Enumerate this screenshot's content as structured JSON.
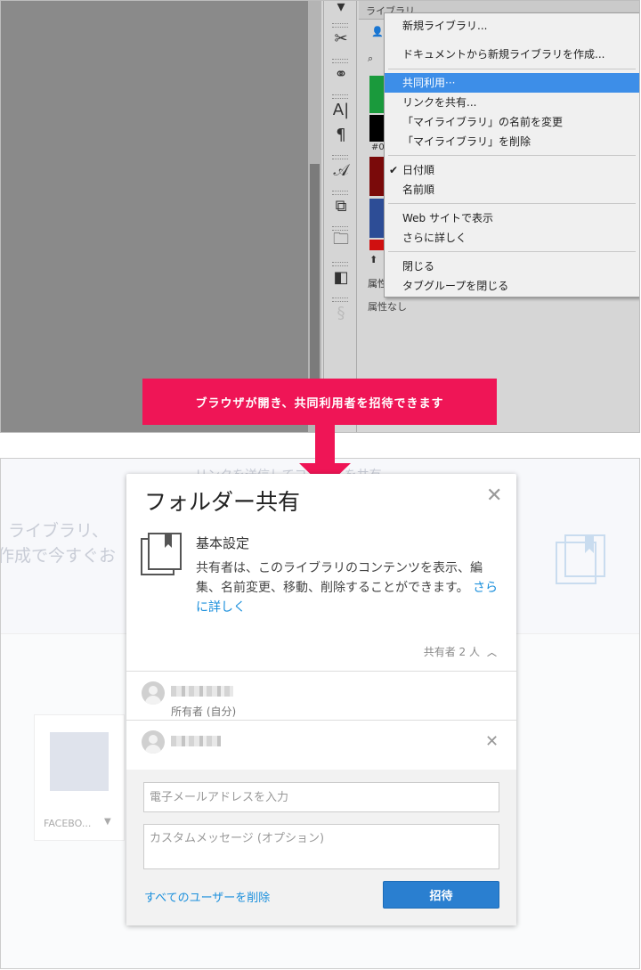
{
  "photoshop": {
    "library_panel_title": "ライブラリ",
    "swatch_label": "#0",
    "attribute_label": "属性",
    "attribute_value": "属性なし",
    "tools": [
      {
        "icon": "scissors-icon",
        "glyph": "✂"
      },
      {
        "icon": "puppet-warp-icon",
        "glyph": "⚭"
      },
      {
        "icon": "character-panel-icon",
        "glyph": "A|"
      },
      {
        "icon": "paragraph-icon",
        "glyph": "¶"
      },
      {
        "icon": "glyph-panel-icon",
        "glyph": "𝒜"
      },
      {
        "icon": "layer-comps-icon",
        "glyph": "⧉"
      },
      {
        "icon": "history-folder-icon",
        "glyph": "🗀"
      },
      {
        "icon": "clone-source-icon",
        "glyph": "◧"
      },
      {
        "icon": "stamp-icon",
        "glyph": "§"
      }
    ],
    "menu": {
      "items": [
        {
          "label": "新規ライブラリ...",
          "highlighted": false,
          "checked": false
        },
        {
          "label": "ドキュメントから新規ライブラリを作成...",
          "highlighted": false,
          "checked": false
        },
        {
          "label": "共同利用···",
          "highlighted": true,
          "checked": false
        },
        {
          "label": "リンクを共有...",
          "highlighted": false,
          "checked": false
        },
        {
          "label": "「マイライブラリ」の名前を変更",
          "highlighted": false,
          "checked": false
        },
        {
          "label": "「マイライブラリ」を削除",
          "highlighted": false,
          "checked": false
        },
        {
          "label": "日付順",
          "highlighted": false,
          "checked": true
        },
        {
          "label": "名前順",
          "highlighted": false,
          "checked": false
        },
        {
          "label": "Web サイトで表示",
          "highlighted": false,
          "checked": false
        },
        {
          "label": "さらに詳しく",
          "highlighted": false,
          "checked": false
        },
        {
          "label": "閉じる",
          "highlighted": false,
          "checked": false
        },
        {
          "label": "タブグループを閉じる",
          "highlighted": false,
          "checked": false
        }
      ],
      "check_glyph": "✔"
    }
  },
  "callout": {
    "text": "ブラウザが開き、共同利用者を招待できます"
  },
  "web": {
    "bg_text_line1": "ライブラリ、",
    "bg_text_line2": "作成で今すぐお",
    "bg_top_text": "リンクを送信してコメントを共有",
    "bg_card_caption": "FACEBO...",
    "dialog": {
      "title": "フォルダー共有",
      "close_glyph": "✕",
      "basic_title": "基本設定",
      "basic_desc": "共有者は、このライブラリのコンテンツを表示、編集、名前変更、移動、削除することができます。",
      "learn_more": "さらに詳しく",
      "sharers_label": "共有者 2 人",
      "sharers_chevron": "︿",
      "owner_role": "所有者 (自分)",
      "remove_glyph": "✕",
      "email_placeholder": "電子メールアドレスを入力",
      "message_placeholder": "カスタムメッセージ (オプション)",
      "remove_all": "すべてのユーザーを削除",
      "invite_label": "招待"
    }
  },
  "colors": {
    "callout": "#ef1556",
    "menu_highlight": "#3d8ee8",
    "link": "#1a8fdc",
    "invite_button": "#2a7fd0",
    "swatches": [
      "#1a9a3c",
      "#000000",
      "#7a0a0a",
      "#2d4d96",
      "#d01010"
    ]
  }
}
